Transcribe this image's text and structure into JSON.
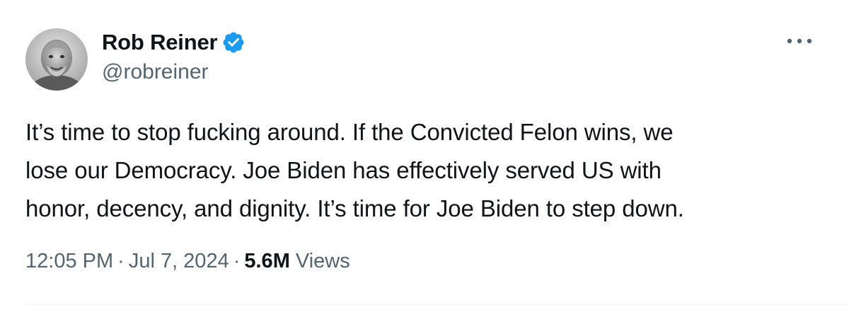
{
  "author": {
    "display_name": "Rob Reiner",
    "handle": "@robreiner",
    "verified_color": "#1d9bf0",
    "avatar_icon": "person-photo-icon"
  },
  "tweet": {
    "lines": [
      "It’s time to stop fucking around. If the Convicted Felon wins, we",
      "lose our Democracy. Joe Biden has effectively served US with",
      "honor, decency, and dignity. It’s time for Joe Biden to step down."
    ]
  },
  "meta": {
    "time": "12:05 PM",
    "separator": "·",
    "date": "Jul 7, 2024",
    "views_count": "5.6M",
    "views_label": "Views"
  },
  "icons": {
    "more": "more-horizontal-icon",
    "verified": "verified-badge-icon"
  }
}
